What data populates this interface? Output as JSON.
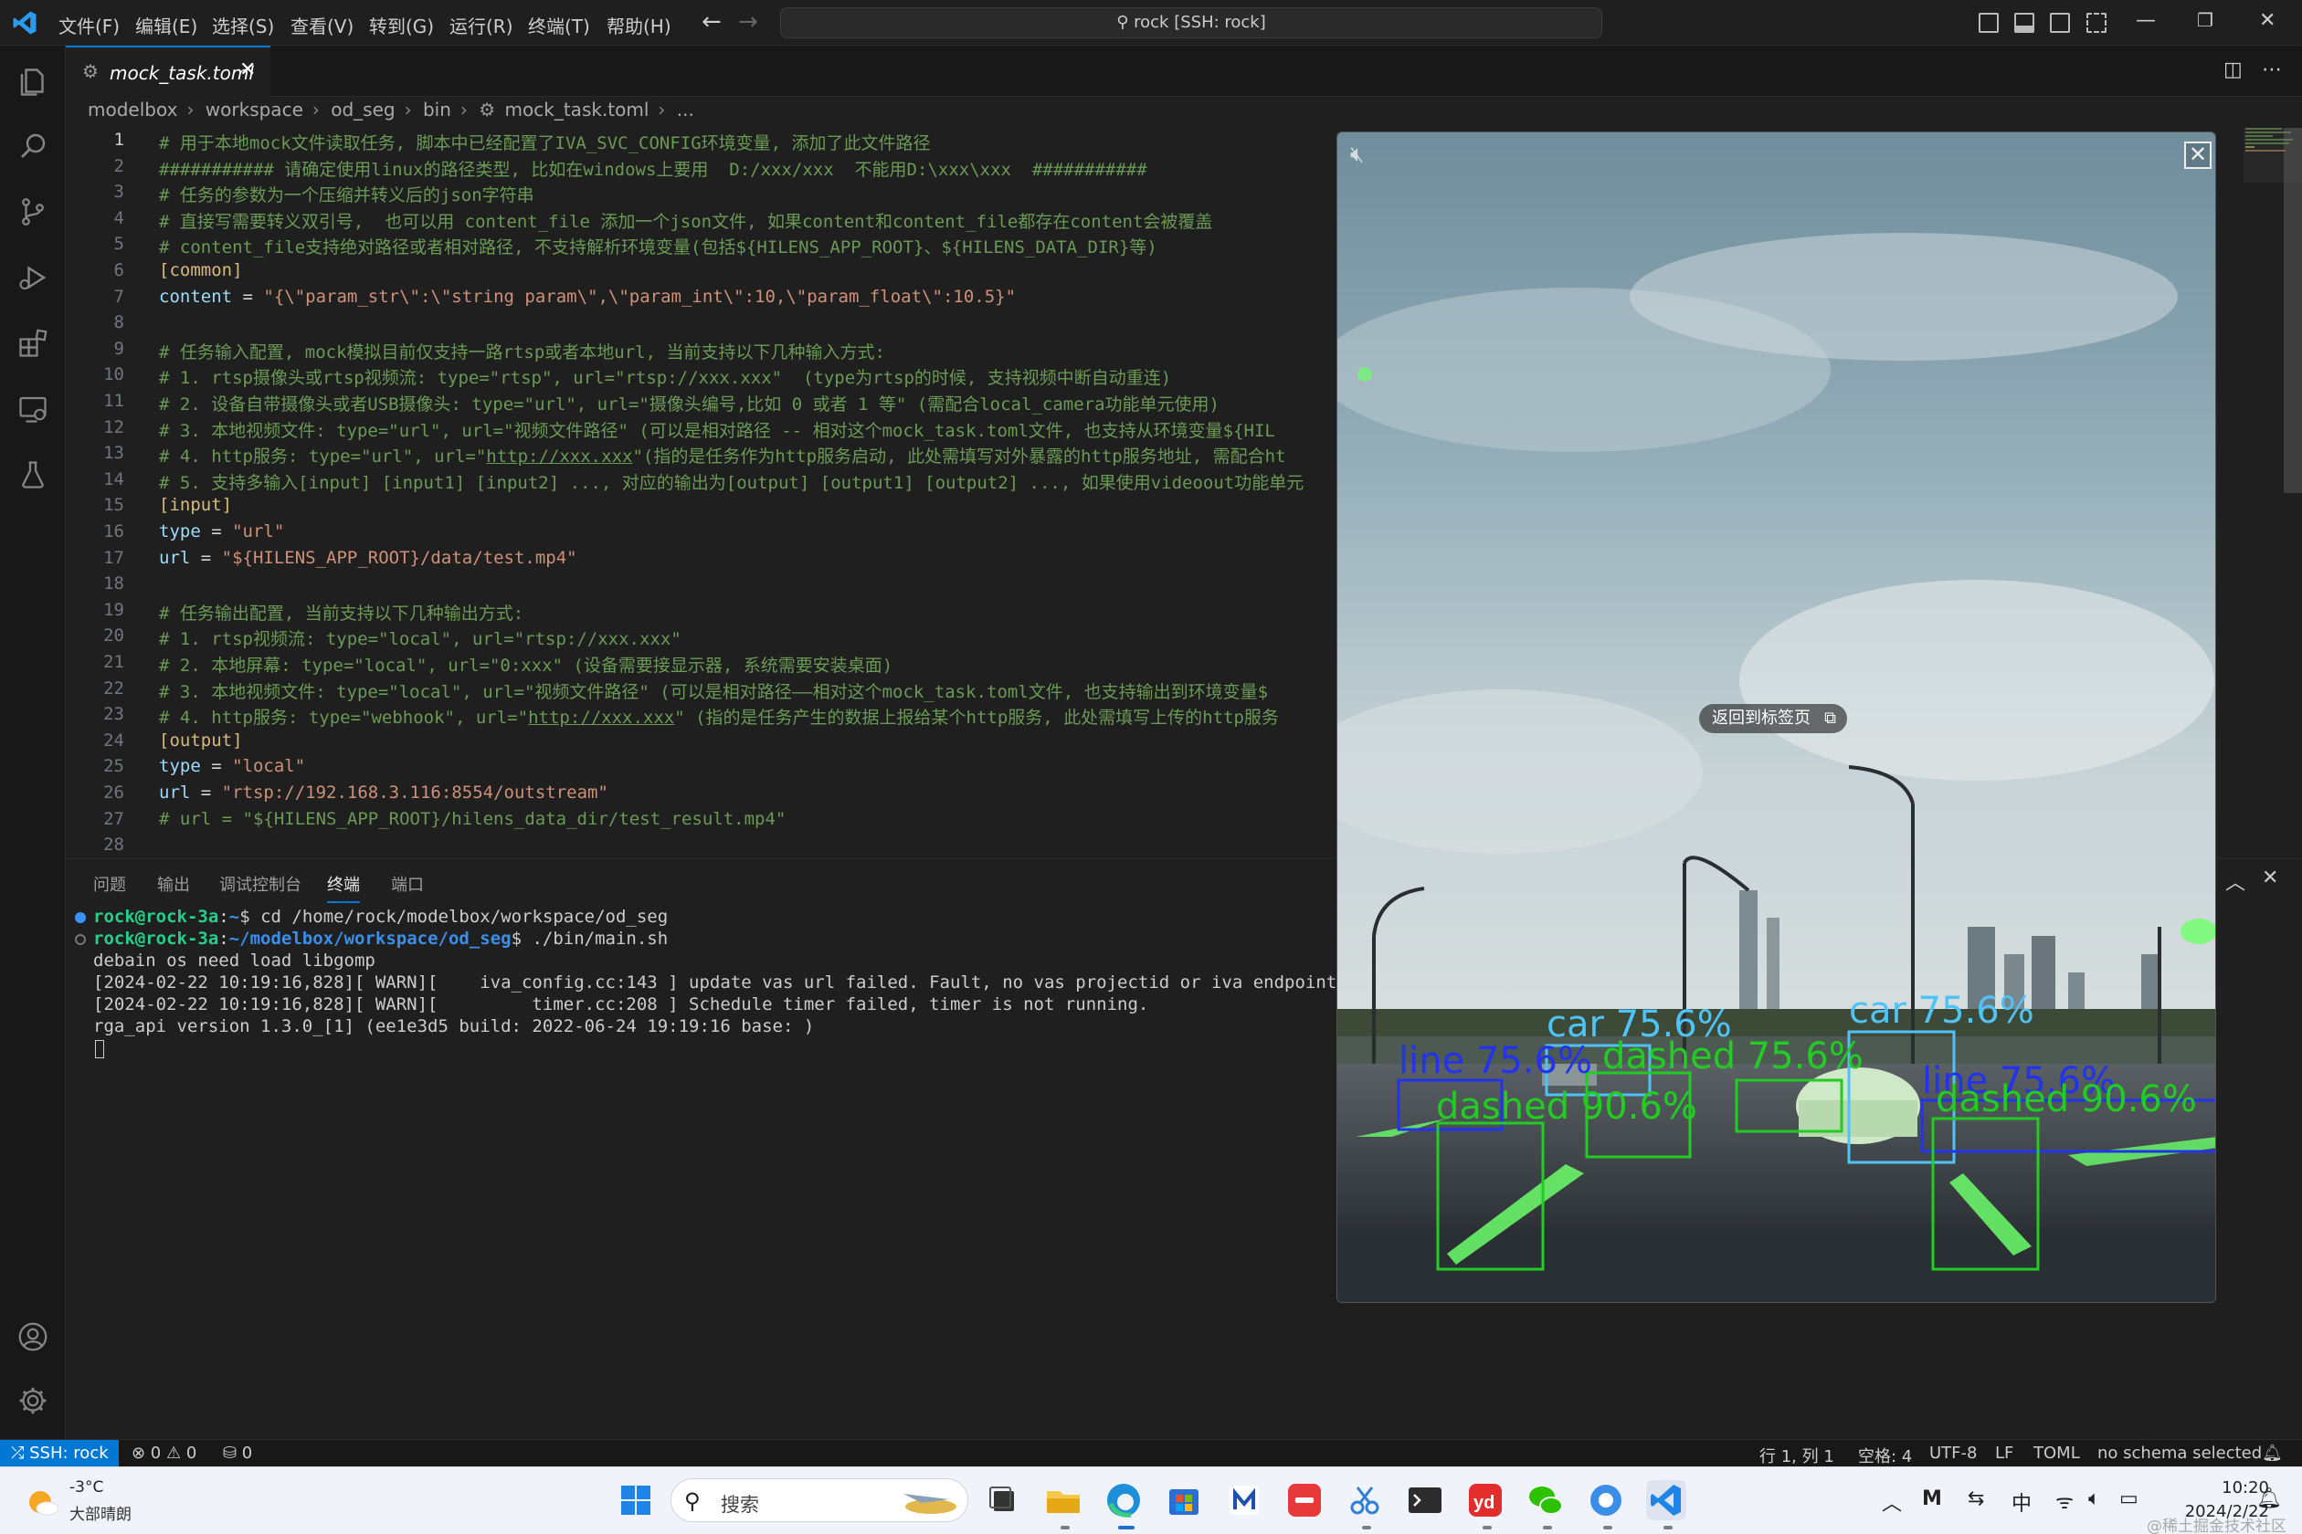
{
  "titlebar": {
    "menus": [
      "文件(F)",
      "编辑(E)",
      "选择(S)",
      "查看(V)",
      "转到(G)",
      "运行(R)",
      "终端(T)",
      "帮助(H)"
    ],
    "search_text": "rock [SSH: rock]"
  },
  "tab": {
    "label": "mock_task.toml",
    "close": "✕"
  },
  "breadcrumb": [
    "modelbox",
    "workspace",
    "od_seg",
    "bin",
    "mock_task.toml",
    "..."
  ],
  "editor": {
    "current_line": 1,
    "lines": [
      {
        "n": "1",
        "segments": [
          {
            "t": "# 用于本地mock文件读取任务, 脚本中已经配置了IVA_SVC_CONFIG环境变量, 添加了此文件路径",
            "c": "c-com"
          }
        ]
      },
      {
        "n": "2",
        "segments": [
          {
            "t": "########### 请确定使用linux的路径类型, 比如在windows上要用  D:/xxx/xxx  不能用D:\\xxx\\xxx  ###########",
            "c": "c-com"
          }
        ]
      },
      {
        "n": "3",
        "segments": [
          {
            "t": "# 任务的参数为一个压缩并转义后的json字符串",
            "c": "c-com"
          }
        ]
      },
      {
        "n": "4",
        "segments": [
          {
            "t": "# 直接写需要转义双引号,  也可以用 content_file 添加一个json文件, 如果content和content_file都存在content会被覆盖",
            "c": "c-com"
          }
        ]
      },
      {
        "n": "5",
        "segments": [
          {
            "t": "# content_file支持绝对路径或者相对路径, 不支持解析环境变量(包括${HILENS_APP_ROOT}、${HILENS_DATA_DIR}等)",
            "c": "c-com"
          }
        ]
      },
      {
        "n": "6",
        "segments": [
          {
            "t": "[common]",
            "c": "c-sec"
          }
        ]
      },
      {
        "n": "7",
        "segments": [
          {
            "t": "content",
            "c": "c-key"
          },
          {
            "t": " = ",
            "c": "c-plain"
          },
          {
            "t": "\"{\\\"param_str\\\":\\\"string param\\\",\\\"param_int\\\":10,\\\"param_float\\\":10.5}\"",
            "c": "c-str"
          }
        ]
      },
      {
        "n": "8",
        "segments": []
      },
      {
        "n": "9",
        "segments": [
          {
            "t": "# 任务输入配置, mock模拟目前仅支持一路rtsp或者本地url, 当前支持以下几种输入方式:",
            "c": "c-com"
          }
        ]
      },
      {
        "n": "10",
        "segments": [
          {
            "t": "# 1. rtsp摄像头或rtsp视频流: type=\"rtsp\", url=\"rtsp://xxx.xxx\"  (type为rtsp的时候, 支持视频中断自动重连)",
            "c": "c-com"
          }
        ]
      },
      {
        "n": "11",
        "segments": [
          {
            "t": "# 2. 设备自带摄像头或者USB摄像头: type=\"url\", url=\"摄像头编号,比如 0 或者 1 等\" (需配合local_camera功能单元使用)",
            "c": "c-com"
          }
        ]
      },
      {
        "n": "12",
        "segments": [
          {
            "t": "# 3. 本地视频文件: type=\"url\", url=\"视频文件路径\" (可以是相对路径 -- 相对这个mock_task.toml文件, 也支持从环境变量${HIL",
            "c": "c-com"
          }
        ]
      },
      {
        "n": "13",
        "segments": [
          {
            "t": "# 4. http服务: type=\"url\", url=\"",
            "c": "c-com"
          },
          {
            "t": "http://xxx.xxx",
            "c": "c-com c-link"
          },
          {
            "t": "\"(指的是任务作为http服务启动, 此处需填写对外暴露的http服务地址, 需配合ht",
            "c": "c-com"
          }
        ]
      },
      {
        "n": "14",
        "segments": [
          {
            "t": "# 5. 支持多输入[input] [input1] [input2] ..., 对应的输出为[output] [output1] [output2] ..., 如果使用videoout功能单元",
            "c": "c-com"
          }
        ]
      },
      {
        "n": "15",
        "segments": [
          {
            "t": "[input]",
            "c": "c-sec"
          }
        ]
      },
      {
        "n": "16",
        "segments": [
          {
            "t": "type",
            "c": "c-key"
          },
          {
            "t": " = ",
            "c": "c-plain"
          },
          {
            "t": "\"url\"",
            "c": "c-str"
          }
        ]
      },
      {
        "n": "17",
        "segments": [
          {
            "t": "url",
            "c": "c-key"
          },
          {
            "t": " = ",
            "c": "c-plain"
          },
          {
            "t": "\"${HILENS_APP_ROOT}/data/test.mp4\"",
            "c": "c-str"
          }
        ]
      },
      {
        "n": "18",
        "segments": []
      },
      {
        "n": "19",
        "segments": [
          {
            "t": "# 任务输出配置, 当前支持以下几种输出方式:",
            "c": "c-com"
          }
        ]
      },
      {
        "n": "20",
        "segments": [
          {
            "t": "# 1. rtsp视频流: type=\"local\", url=\"rtsp://xxx.xxx\"",
            "c": "c-com"
          }
        ]
      },
      {
        "n": "21",
        "segments": [
          {
            "t": "# 2. 本地屏幕: type=\"local\", url=\"0:xxx\" (设备需要接显示器, 系统需要安装桌面)",
            "c": "c-com"
          }
        ]
      },
      {
        "n": "22",
        "segments": [
          {
            "t": "# 3. 本地视频文件: type=\"local\", url=\"视频文件路径\" (可以是相对路径——相对这个mock_task.toml文件, 也支持输出到环境变量$",
            "c": "c-com"
          }
        ]
      },
      {
        "n": "23",
        "segments": [
          {
            "t": "# 4. http服务: type=\"webhook\", url=\"",
            "c": "c-com"
          },
          {
            "t": "http://xxx.xxx",
            "c": "c-com c-link"
          },
          {
            "t": "\" (指的是任务产生的数据上报给某个http服务, 此处需填写上传的http服务",
            "c": "c-com"
          }
        ]
      },
      {
        "n": "24",
        "segments": [
          {
            "t": "[output]",
            "c": "c-sec"
          }
        ]
      },
      {
        "n": "25",
        "segments": [
          {
            "t": "type",
            "c": "c-key"
          },
          {
            "t": " = ",
            "c": "c-plain"
          },
          {
            "t": "\"local\"",
            "c": "c-str"
          }
        ]
      },
      {
        "n": "26",
        "segments": [
          {
            "t": "url",
            "c": "c-key"
          },
          {
            "t": " = ",
            "c": "c-plain"
          },
          {
            "t": "\"rtsp://192.168.3.116:8554/outstream\"",
            "c": "c-str"
          }
        ]
      },
      {
        "n": "27",
        "segments": [
          {
            "t": "# url = \"${HILENS_APP_ROOT}/hilens_data_dir/test_result.mp4\"",
            "c": "c-com"
          }
        ]
      },
      {
        "n": "28",
        "segments": []
      }
    ]
  },
  "panel": {
    "tabs": [
      "问题",
      "输出",
      "调试控制台",
      "终端",
      "端口"
    ],
    "active_tab": "终端",
    "terminal": [
      {
        "kind": "prompt",
        "status": "blue",
        "user": "rock@rock-3a",
        "path": "~",
        "cmd": "$ cd /home/rock/modelbox/workspace/od_seg"
      },
      {
        "kind": "prompt",
        "status": "hollow",
        "user": "rock@rock-3a",
        "path": "~/modelbox/workspace/od_seg",
        "cmd": "$ ./bin/main.sh"
      },
      {
        "kind": "text",
        "text": "debain os need load libgomp"
      },
      {
        "kind": "text",
        "text": "[2024-02-22 10:19:16,828][ WARN][    iva_config.cc:143 ] update vas url failed. Fault, no vas projectid or iva endpoint"
      },
      {
        "kind": "text",
        "text": "[2024-02-22 10:19:16,828][ WARN][         timer.cc:208 ] Schedule timer failed, timer is not running."
      },
      {
        "kind": "text",
        "text": "rga_api version 1.3.0_[1] (ee1e3d5 build: 2022-06-24 19:19:16 base: )"
      }
    ]
  },
  "video": {
    "back_label": "返回到标签页",
    "detections": [
      {
        "label": "car 75.6%",
        "color": "#4fc3f7"
      },
      {
        "label": "line 75.6%",
        "color": "#2233ee"
      },
      {
        "label": "dashed 90.6%",
        "color": "#22cc22"
      },
      {
        "label": "dashed 75.6%",
        "color": "#22cc22"
      },
      {
        "label": "car 75.6%",
        "color": "#4fc3f7"
      },
      {
        "label": "line 75.6%",
        "color": "#2233ee"
      },
      {
        "label": "dashed 90.6%",
        "color": "#22cc22"
      }
    ]
  },
  "statusbar": {
    "remote": "SSH: rock",
    "problems": "⊗ 0 ⚠ 0",
    "ports": "⛁ 0",
    "position": "行 1, 列 1",
    "spaces": "空格: 4",
    "encoding": "UTF-8",
    "eol": "LF",
    "language": "TOML",
    "schema": "no schema selected"
  },
  "taskbar": {
    "weather_temp": "-3°C",
    "weather_desc": "大部晴朗",
    "search_placeholder": "搜索",
    "tray_ime": "中",
    "time": "10:20",
    "date": "2024/2/22",
    "watermark": "@稀土掘金技术社区"
  },
  "colors": {
    "accent": "#0078d4",
    "comment": "#6a9955",
    "string": "#ce9178",
    "key": "#9cdcfe",
    "section": "#d7ba7d"
  }
}
